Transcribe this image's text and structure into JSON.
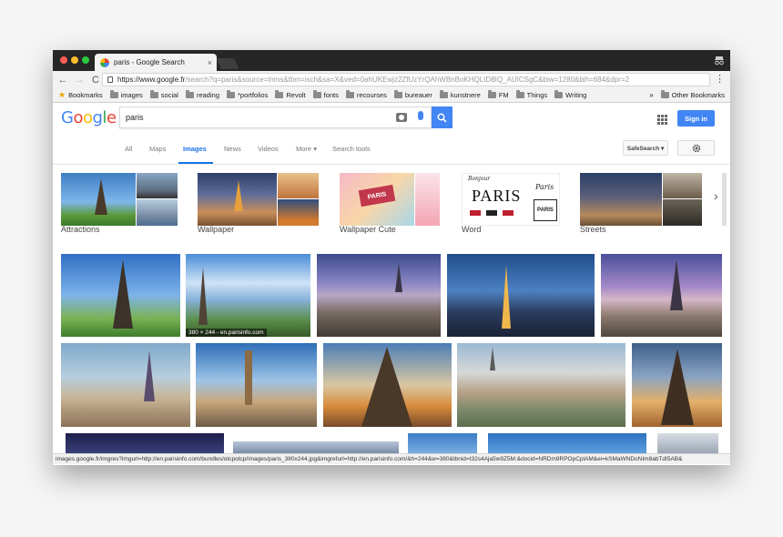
{
  "browser": {
    "tab_title": "paris - Google Search",
    "tab_close": "×",
    "url_host": "https://www.google.fr",
    "url_path": "/search?q=paris&source=lnms&tbm=isch&sa=X&ved=0ahUKEwjz2ZfUzYrQAhWBnBoKHQLtD8IQ_AUICSgC&biw=1280&bih=684&dpr=2",
    "back": "←",
    "forward": "→",
    "reload": "C",
    "menu": "⋮"
  },
  "bookmarks": {
    "items": [
      "Bookmarks",
      "images",
      "social",
      "reading",
      "*portfolios",
      "Revolt",
      "fonts",
      "recourses",
      "bureauer",
      "kunstnere",
      "FM",
      "Things",
      "Writing"
    ],
    "overflow": "»",
    "other": "Other Bookmarks"
  },
  "header": {
    "logo": [
      "G",
      "o",
      "o",
      "g",
      "l",
      "e"
    ],
    "query": "paris",
    "sign_in": "Sign in"
  },
  "tabs": {
    "items": [
      "All",
      "Maps",
      "Images",
      "News",
      "Videos",
      "More",
      "Search tools"
    ],
    "more_caret": "▾",
    "safesearch": "SafeSearch ▾"
  },
  "related": {
    "items": [
      "Attractions",
      "Wallpaper",
      "Wallpaper Cute",
      "Word",
      "Streets"
    ],
    "word_card": {
      "top": "Bonjour",
      "main": "PARIS",
      "bottom": "Paris"
    },
    "cute_card": "PARIS",
    "next_arrow": "›"
  },
  "results": {
    "caption": "380 × 244 - en.parisinfo.com"
  },
  "status_bar": "images.google.fr/imgres?imgurl=http://en.parisinfo.com/bundles/otcpotcp/images/paris_380x244.jpg&imgrefurl=http://en.parisinfo.com/&h=244&w=380&tbnid=t32s4Aja5w9Z5M:&docid=NRDm9RPOpCplAM&ei=kSMaWNDoNIm8abTdI5AB&"
}
